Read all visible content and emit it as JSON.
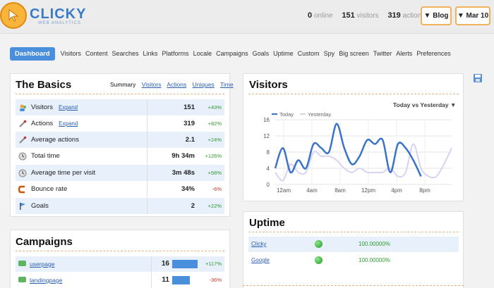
{
  "header": {
    "logo_text": "CLICKY",
    "logo_sub": "WEB ANALYTICS",
    "online_count": "0",
    "online_label": "online",
    "visitors_count": "151",
    "visitors_label": "visitors",
    "actions_count": "319",
    "actions_label": "actions",
    "blog_button": "▼ Blog",
    "date_button": "▼ Mar 10"
  },
  "nav": {
    "dashboard": "Dashboard",
    "items": [
      "Visitors",
      "Content",
      "Searches",
      "Links",
      "Platforms",
      "Locale",
      "Campaigns",
      "Goals",
      "Uptime",
      "Custom",
      "Spy",
      "Big screen",
      "Twitter",
      "Alerts",
      "Preferences"
    ]
  },
  "basics": {
    "title": "The Basics",
    "tabs": [
      "Summary",
      "Visitors",
      "Actions",
      "Uniques",
      "Time"
    ],
    "expand_label": "Expand",
    "rows": [
      {
        "label": "Visitors",
        "value": "151",
        "change": "+43%",
        "icon": "visitors-icon"
      },
      {
        "label": "Actions",
        "value": "319",
        "change": "+82%",
        "icon": "actions-icon"
      },
      {
        "label": "Average actions",
        "value": "2.1",
        "change": "+24%",
        "icon": "average-actions-icon"
      },
      {
        "label": "Total time",
        "value": "9h 34m",
        "change": "+126%",
        "icon": "clock-icon"
      },
      {
        "label": "Average time per visit",
        "value": "3m 48s",
        "change": "+58%",
        "icon": "clock-icon"
      },
      {
        "label": "Bounce rate",
        "value": "34%",
        "change": "-6%",
        "icon": "bounce-icon"
      },
      {
        "label": "Goals",
        "value": "2",
        "change": "+22%",
        "icon": "goals-icon"
      }
    ]
  },
  "campaigns": {
    "title": "Campaigns",
    "rows": [
      {
        "label": "userpage",
        "value": "16",
        "change": "+117%",
        "bar_fraction": 1.0
      },
      {
        "label": "landingpage",
        "value": "11",
        "change": "-36%",
        "bar_fraction": 0.69
      }
    ]
  },
  "visitors_panel": {
    "title": "Visitors",
    "compare_label": "Today vs Yesterday ▼"
  },
  "uptime": {
    "title": "Uptime",
    "rows": [
      {
        "name": "Clicky",
        "percent": "100.00000%"
      },
      {
        "name": "Google",
        "percent": "100.00000%"
      }
    ]
  },
  "colors": {
    "accent": "#4a8fdb",
    "today": "#3a73c8",
    "yesterday": "#d7d3f0",
    "positive": "#2e9a2e",
    "negative": "#c0392b"
  },
  "chart_data": {
    "type": "line",
    "title": "",
    "xlabel": "",
    "ylabel": "",
    "x_ticks": [
      "12am",
      "4am",
      "8am",
      "12pm",
      "4pm",
      "8pm"
    ],
    "y_ticks": [
      0,
      4,
      8,
      12,
      16
    ],
    "ylim": [
      0,
      16
    ],
    "legend_position": "top-left",
    "grid": true,
    "x": [
      0,
      1,
      2,
      3,
      4,
      5,
      6,
      7,
      8,
      9,
      10,
      11,
      12,
      13,
      14,
      15,
      16,
      17,
      18,
      19,
      20,
      21,
      22,
      23
    ],
    "series": [
      {
        "name": "Today",
        "values": [
          4,
          9,
          3,
          6,
          4,
          10,
          9,
          8,
          15,
          9,
          5,
          7,
          11,
          10,
          11,
          3,
          10,
          9,
          6,
          2,
          null,
          null,
          null,
          null
        ]
      },
      {
        "name": "Yesterday",
        "values": [
          3,
          1,
          5,
          3,
          3,
          8,
          7,
          7,
          6,
          4,
          3,
          4,
          3,
          3,
          3,
          4,
          2,
          3,
          10,
          4,
          2,
          2,
          5,
          9
        ]
      }
    ]
  }
}
